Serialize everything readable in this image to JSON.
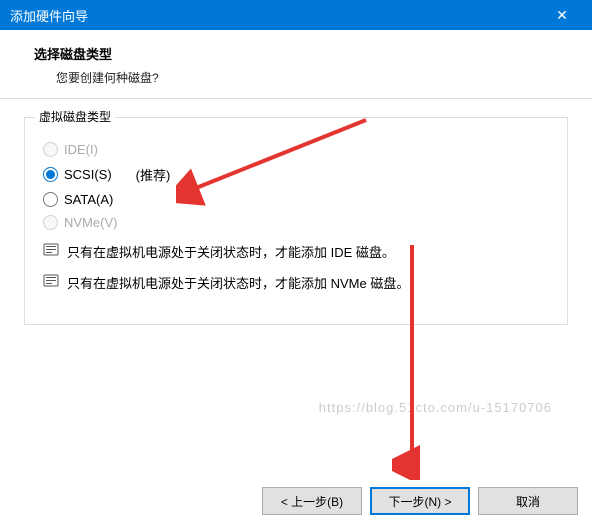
{
  "window": {
    "title": "添加硬件向导"
  },
  "header": {
    "title": "选择磁盘类型",
    "subtitle": "您要创建何种磁盘?"
  },
  "group": {
    "label": "虚拟磁盘类型",
    "options": {
      "ide": "IDE(I)",
      "scsi": "SCSI(S)",
      "scsi_recommend": "(推荐)",
      "sata": "SATA(A)",
      "nvme": "NVMe(V)"
    },
    "info1": "只有在虚拟机电源处于关闭状态时，才能添加 IDE 磁盘。",
    "info2": "只有在虚拟机电源处于关闭状态时，才能添加 NVMe 磁盘。"
  },
  "buttons": {
    "back": "< 上一步(B)",
    "next": "下一步(N) >",
    "cancel": "取消"
  },
  "watermark": "https://blog.51cto.com/u-15170706"
}
